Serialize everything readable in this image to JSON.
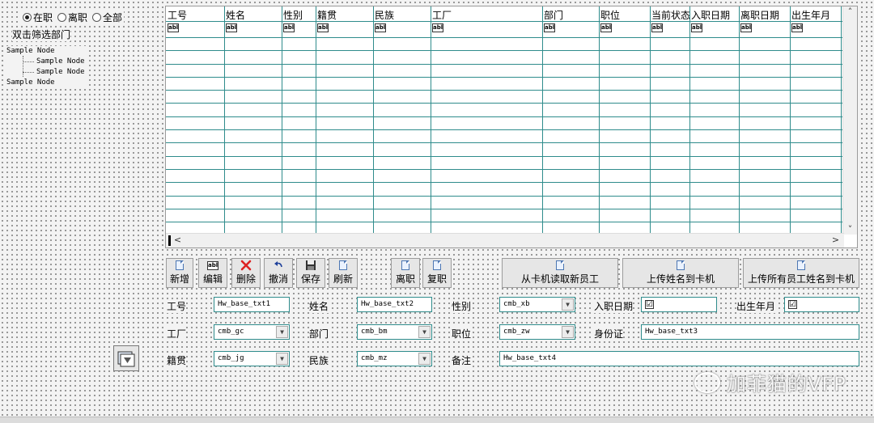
{
  "left_panel": {
    "radios": [
      {
        "label": "在职",
        "selected": true
      },
      {
        "label": "离职",
        "selected": false
      },
      {
        "label": "全部",
        "selected": false
      }
    ],
    "filter_label": "双击筛选部门",
    "tree": {
      "root1": "Sample Node",
      "child1": "Sample Node",
      "child2": "Sample Node",
      "root2": "Sample Node"
    }
  },
  "grid": {
    "columns": [
      "工号",
      "姓名",
      "性别",
      "籍贯",
      "民族",
      "工厂",
      "部门",
      "职位",
      "当前状态",
      "入职日期",
      "离职日期",
      "出生年月"
    ],
    "text_icon": "abl",
    "scroll_up": "˄",
    "scroll_down": "˅",
    "scroll_left": "<",
    "scroll_right": ">"
  },
  "toolbar": {
    "add": "新增",
    "edit": "编辑",
    "delete": "删除",
    "undo": "撤消",
    "save": "保存",
    "refresh": "刷新",
    "leave": "离职",
    "rehire": "复职",
    "read_card": "从卡机读取新员工",
    "upload_name": "上传姓名到卡机",
    "upload_all": "上传所有员工姓名到卡机",
    "edit_icon": "abl"
  },
  "form": {
    "labels": {
      "emp_no": "工号",
      "name": "姓名",
      "gender": "性别",
      "hire_date": "入职日期",
      "birth": "出生年月",
      "factory": "工厂",
      "dept": "部门",
      "position": "职位",
      "id_card": "身份证",
      "origin": "籍贯",
      "ethnic": "民族",
      "remark": "备注"
    },
    "values": {
      "emp_no": "Hw_base_txt1",
      "name": "Hw_base_txt2",
      "gender": "cmb_xb",
      "factory": "cmb_gc",
      "dept": "cmb_bm",
      "position": "cmb_zw",
      "id_card": "Hw_base_txt3",
      "origin": "cmb_jg",
      "ethnic": "cmb_mz",
      "remark": "Hw_base_txt4"
    },
    "check_mark": "☑",
    "dropdown_glyph": "▼"
  },
  "watermark": "加菲猫的VFP"
}
